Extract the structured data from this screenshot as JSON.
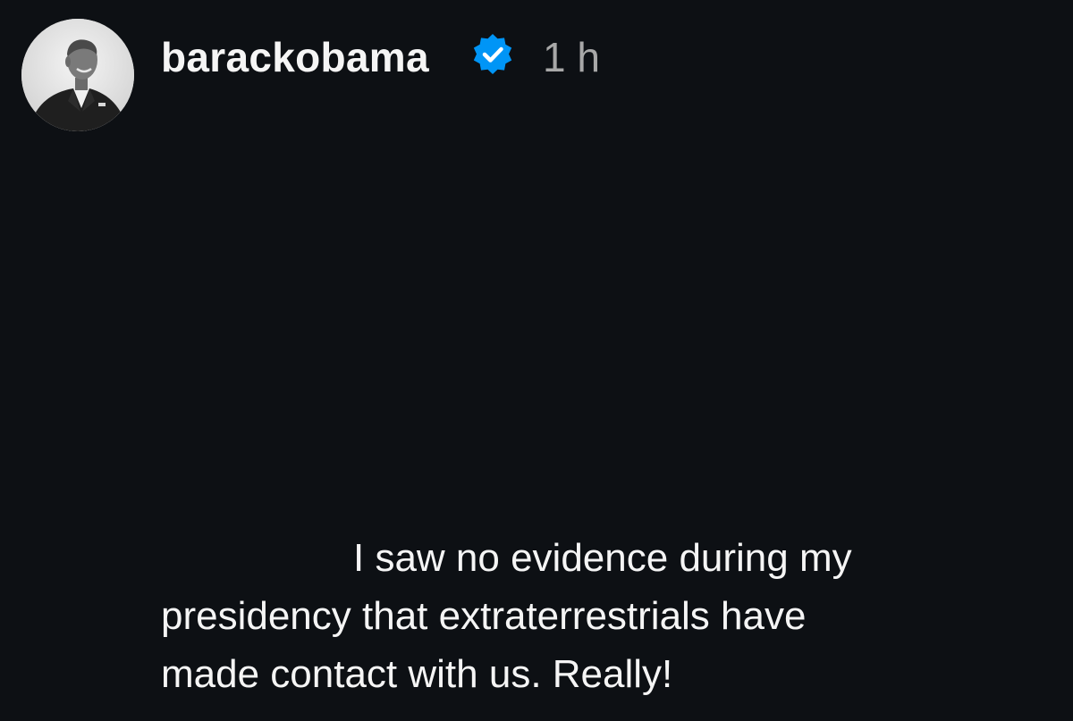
{
  "post": {
    "username": "barackobama",
    "timestamp": "1 h",
    "avatar_icon": "profile-photo-icon",
    "verified_icon": "verified-badge-icon",
    "verified_color": "#0095f6",
    "caption_lines": [
      "I saw no evidence during my",
      "presidency that extraterrestrials have",
      "made contact with us. Really!"
    ]
  },
  "colors": {
    "background": "#0d1014",
    "text_primary": "#f5f5f5",
    "text_secondary": "#a8a8a8"
  }
}
